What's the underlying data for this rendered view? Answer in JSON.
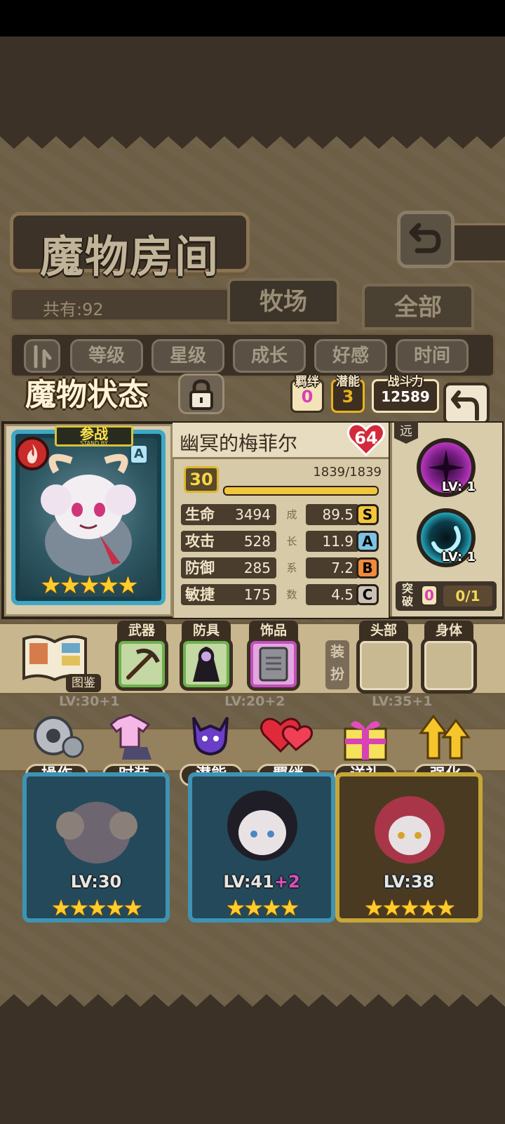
{
  "header": {
    "title": "魔物房间"
  },
  "room": {
    "count_text": "共有:92"
  },
  "tabs": [
    {
      "label": "牧场"
    },
    {
      "label": "全部"
    }
  ],
  "sort": {
    "buttons": [
      {
        "label": "等级"
      },
      {
        "label": "星级"
      },
      {
        "label": "成长"
      },
      {
        "label": "好感"
      },
      {
        "label": "时间"
      }
    ]
  },
  "status": {
    "title": "魔物状态",
    "chips": [
      {
        "label": "羁绊",
        "value": "0",
        "color": "#d83fb6"
      },
      {
        "label": "潜能",
        "value": "3",
        "color": "#e9b31c"
      },
      {
        "label": "战斗力",
        "value": "12589",
        "color": "#ffffff"
      }
    ]
  },
  "monster": {
    "name": "幽冥的梅菲尔",
    "affection": "64",
    "standby_label": "参战",
    "standby_sub": "STAND BY",
    "rank_letter": "A",
    "element_icon": "fire-icon",
    "stars": "★★★★★",
    "level": "30",
    "exp_text": "1839/1839",
    "exp_fraction": 1.0,
    "growth_header": [
      "成",
      "长",
      "系",
      "数"
    ],
    "stats": [
      {
        "label": "生命",
        "value": "3494",
        "growth": "89.5",
        "grade": "S",
        "grade_color": "#f2c53a"
      },
      {
        "label": "攻击",
        "value": "528",
        "growth": "11.9",
        "grade": "A",
        "grade_color": "#7bc3e6"
      },
      {
        "label": "防御",
        "value": "285",
        "growth": "7.2",
        "grade": "B",
        "grade_color": "#f08a3c"
      },
      {
        "label": "敏捷",
        "value": "175",
        "growth": "4.5",
        "grade": "C",
        "grade_color": "#c9c2b4"
      }
    ],
    "range": "远",
    "skills": [
      {
        "level": "LV: 1"
      },
      {
        "level": "LV: 1"
      }
    ],
    "breakthrough": {
      "label": "突破",
      "count": "0",
      "progress": "0/1"
    }
  },
  "equipment": {
    "book_label": "图鉴",
    "slots": [
      {
        "label": "武器"
      },
      {
        "label": "防具"
      },
      {
        "label": "饰品"
      }
    ],
    "dress_label": "装扮",
    "dress_slots": [
      {
        "label": "头部"
      },
      {
        "label": "身体"
      }
    ]
  },
  "actions": [
    {
      "label": "操作"
    },
    {
      "label": "时装"
    },
    {
      "label": "潜能"
    },
    {
      "label": "羁绊"
    },
    {
      "label": "送礼"
    },
    {
      "label": "强化"
    }
  ],
  "list": {
    "peek_levels": [
      "LV:30+1",
      "LV:20+2",
      "LV:35+1"
    ],
    "cards": [
      {
        "level": "LV:30",
        "plus": "",
        "stars": "★★★★★"
      },
      {
        "level": "LV:41",
        "plus": "+2",
        "stars": "★★★★"
      },
      {
        "level": "LV:38",
        "plus": "",
        "stars": "★★★★★"
      }
    ]
  }
}
